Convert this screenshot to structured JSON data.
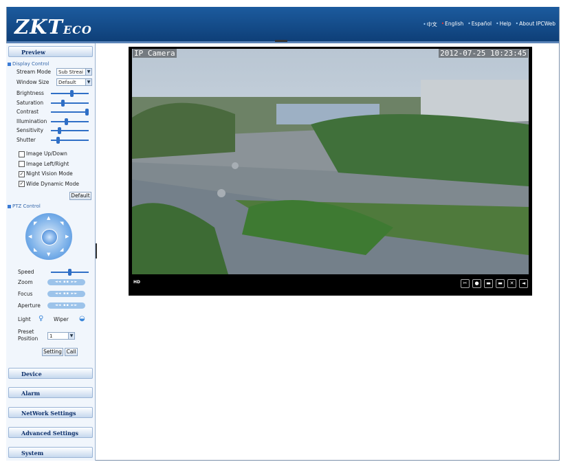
{
  "header": {
    "logo": "ZKT",
    "logo_suffix": "ECO",
    "links": [
      "中文",
      "English",
      "Español",
      "Help",
      "About IPCWeb"
    ]
  },
  "sidebar": {
    "preview": "Preview",
    "display_control": {
      "title": "Display Control",
      "stream_mode_label": "Stream Mode",
      "stream_mode_value": "Sub Streai",
      "window_size_label": "Window Size",
      "window_size_value": "Default",
      "sliders": [
        {
          "label": "Brightness",
          "value": 0.55
        },
        {
          "label": "Saturation",
          "value": 0.3
        },
        {
          "label": "Contrast",
          "value": 1.0
        },
        {
          "label": "Illumination",
          "value": 0.4
        },
        {
          "label": "Sensitivity",
          "value": 0.2
        },
        {
          "label": "Shutter",
          "value": 0.15
        }
      ],
      "checkboxes": [
        {
          "label": "Image Up/Down",
          "checked": false
        },
        {
          "label": "Image Left/Right",
          "checked": false
        },
        {
          "label": "Night Vision Mode",
          "checked": true
        },
        {
          "label": "Wide Dynamic Mode",
          "checked": true
        }
      ],
      "default_button": "Default"
    },
    "ptz_control": {
      "title": "PTZ Control",
      "speed_label": "Speed",
      "speed_value": 0.5,
      "zoom_label": "Zoom",
      "focus_label": "Focus",
      "aperture_label": "Aperture",
      "light_label": "Light",
      "wiper_label": "Wiper",
      "preset_label_1": "Preset",
      "preset_label_2": "Position",
      "preset_value": "1",
      "setting_button": "Setting",
      "call_button": "Call"
    },
    "sections": [
      "Device",
      "Alarm",
      "NetWork Settings",
      "Advanced Settings",
      "System"
    ]
  },
  "video": {
    "title_osd": "IP Camera",
    "timestamp_osd": "2012-07-25 10:23:45",
    "quality": "HD"
  },
  "colors": {
    "header": "#1c5b9e",
    "accent": "#2f6fc6",
    "sidebar_bg": "#f1f6fc"
  }
}
